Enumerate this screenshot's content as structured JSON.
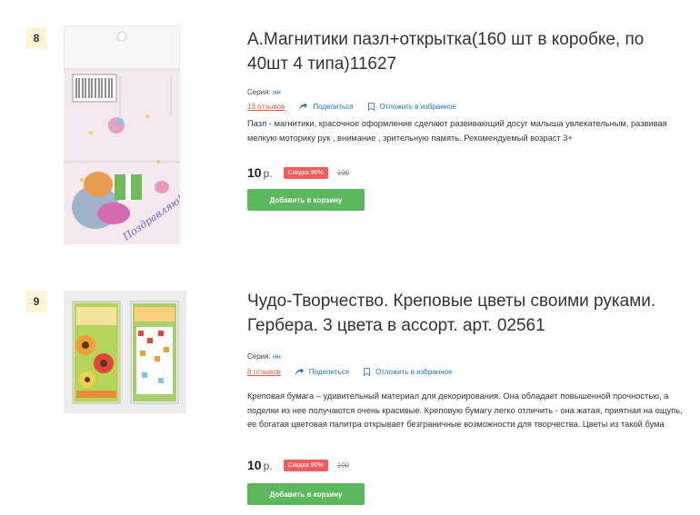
{
  "products": [
    {
      "number": "8",
      "title": "А.Магнитики пазл+открытка(160 шт в коробке, по 40шт 4 типа)11627",
      "series_label": "Серия:",
      "series_value": "нн",
      "reviews": "13 отзывов",
      "share": "Поделиться",
      "favorite": "Отложить в избранное",
      "description": "Пазл - магнитики, красочное оформление сделают развивающий досуг малыша увлекательным, развивая мелкую моторику рук , внимание , зрительную память. Рекомендуемый возраст 3+",
      "price": "10",
      "currency": "р.",
      "discount": "Скидка 90%",
      "old_price": "100",
      "cart_button": "Добавить в корзину",
      "image_caption": "Поздравляю!"
    },
    {
      "number": "9",
      "title": "Чудо-Творчество. Креповые цветы своими руками. Гербера. 3 цвета в ассорт. арт. 02561",
      "series_label": "Серия:",
      "series_value": "нн",
      "reviews": "8 отзывов",
      "share": "Поделиться",
      "favorite": "Отложить в избранное",
      "description": "Креповая бумага – удивительный материал для декорирования. Она обладает повышенной прочностью, а поделки из нее получаются очень красивые. Креповую бумагу легко отличить - она жатая, приятная на ощупь, ее богатая цветовая палитра открывает безграничные возможности для творчества. Цветы из такой бума",
      "price": "10",
      "currency": "р.",
      "discount": "Скидка 90%",
      "old_price": "100",
      "cart_button": "Добавить в корзину"
    }
  ],
  "colors": {
    "accent_link": "#1e73be",
    "reviews": "#e05a47",
    "badge": "#f25c5c",
    "cart": "#5cb85c",
    "number_bg": "#fdf3d6"
  }
}
